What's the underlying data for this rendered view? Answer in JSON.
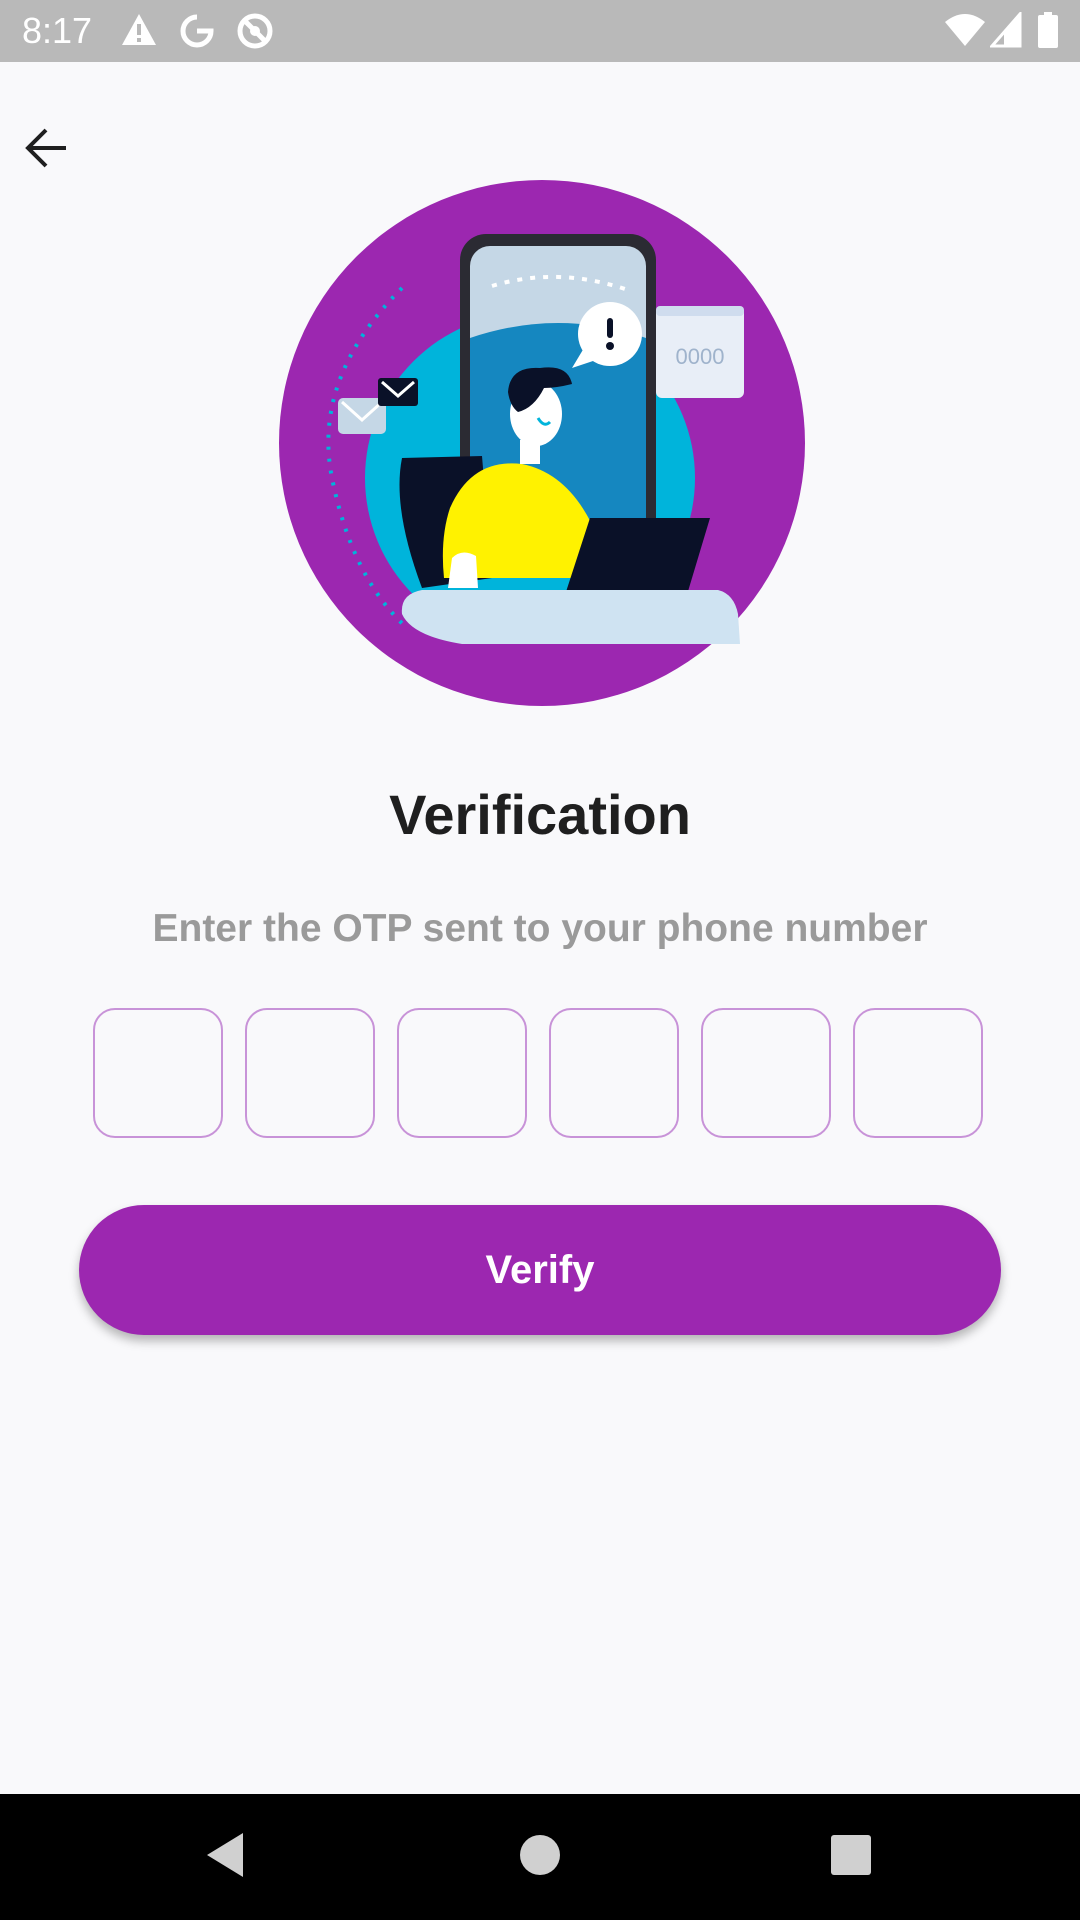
{
  "status_bar": {
    "time": "8:17",
    "left_icons": [
      "warning-icon",
      "google-icon",
      "at-sign-icon"
    ],
    "right_icons": [
      "wifi-icon",
      "signal-icon",
      "battery-icon"
    ]
  },
  "header": {
    "back_icon": "arrow-left-icon"
  },
  "illustration": {
    "otp_digits_placeholder": "0000",
    "colors": {
      "circle": "#9c27b0",
      "screen": "#00b4db",
      "shirt": "#fff200",
      "desk": "#cfe3f2",
      "dark": "#0a1128"
    }
  },
  "main": {
    "title": "Verification",
    "subtitle": "Enter the OTP sent to your phone number",
    "otp": {
      "length": 6,
      "values": [
        "",
        "",
        "",
        "",
        "",
        ""
      ]
    },
    "verify_label": "Verify"
  },
  "nav_bar": {
    "back_icon": "triangle-back-icon",
    "home_icon": "circle-home-icon",
    "recents_icon": "square-recents-icon"
  },
  "colors": {
    "accent": "#9c27b0",
    "otp_border": "#c893d8",
    "title": "#1f1f1f",
    "subtitle": "#9a9a9a",
    "background": "#f9f9fb"
  }
}
